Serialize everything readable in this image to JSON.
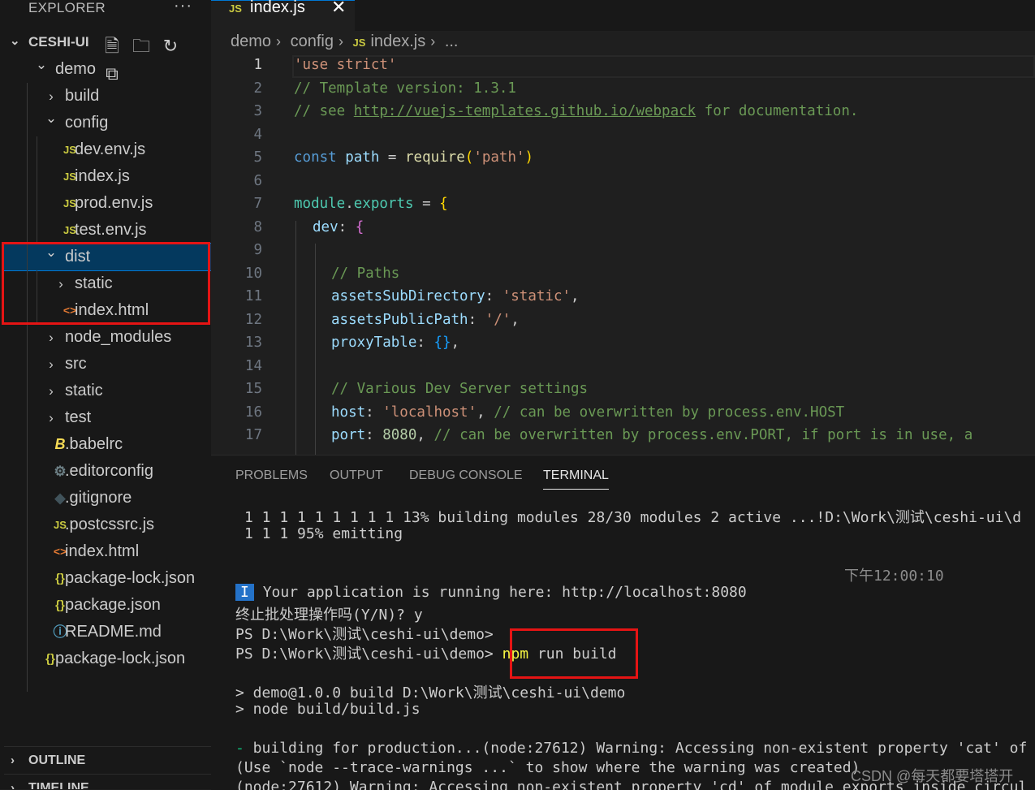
{
  "sidebar": {
    "title": "EXPLORER",
    "more": "···",
    "root": "CESHI-UI",
    "actions": [
      "new-file-icon",
      "new-folder-icon",
      "refresh-icon",
      "collapse-icon"
    ],
    "items": [
      {
        "label": "demo",
        "kind": "folder-open"
      },
      {
        "label": "build",
        "kind": "folder"
      },
      {
        "label": "config",
        "kind": "folder-open"
      },
      {
        "label": "dev.env.js",
        "kind": "js"
      },
      {
        "label": "index.js",
        "kind": "js"
      },
      {
        "label": "prod.env.js",
        "kind": "js"
      },
      {
        "label": "test.env.js",
        "kind": "js"
      },
      {
        "label": "dist",
        "kind": "folder-open"
      },
      {
        "label": "static",
        "kind": "folder"
      },
      {
        "label": "index.html",
        "kind": "html"
      },
      {
        "label": "node_modules",
        "kind": "folder"
      },
      {
        "label": "src",
        "kind": "folder"
      },
      {
        "label": "static",
        "kind": "folder"
      },
      {
        "label": "test",
        "kind": "folder"
      },
      {
        "label": ".babelrc",
        "kind": "babel"
      },
      {
        "label": ".editorconfig",
        "kind": "gear"
      },
      {
        "label": ".gitignore",
        "kind": "git"
      },
      {
        "label": ".postcssrc.js",
        "kind": "js"
      },
      {
        "label": "index.html",
        "kind": "html"
      },
      {
        "label": "package-lock.json",
        "kind": "json"
      },
      {
        "label": "package.json",
        "kind": "json"
      },
      {
        "label": "README.md",
        "kind": "info"
      },
      {
        "label": "package-lock.json",
        "kind": "json"
      }
    ],
    "icons": {
      "js": "JS",
      "json": "{}",
      "html": "<>",
      "babel": "B",
      "gear": "⚙",
      "git": "◆",
      "info": "ⓘ"
    },
    "outline": "OUTLINE",
    "timeline": "TIMELINE"
  },
  "editor": {
    "tab": {
      "icon": "JS",
      "name": "index.js",
      "close": "✕"
    },
    "breadcrumb": {
      "a": "demo",
      "b": "config",
      "icon": "JS",
      "c": "index.js",
      "d": "..."
    },
    "line_numbers": [
      "1",
      "2",
      "3",
      "4",
      "5",
      "6",
      "7",
      "8",
      "9",
      "10",
      "11",
      "12",
      "13",
      "14",
      "15",
      "16",
      "17"
    ],
    "lines": {
      "l1": "'use strict'",
      "l2": "// Template version: 1.3.1",
      "l3a": "// see ",
      "l3b": "http://vuejs-templates.github.io/webpack",
      "l3c": " for documentation.",
      "l5a": "const",
      "l5b": "path",
      "l5c": "require",
      "l5d": "'path'",
      "l7a": "module",
      "l7b": "exports",
      "l8": "dev",
      "l10": "// Paths",
      "l11a": "assetsSubDirectory",
      "l11b": "'static'",
      "l12a": "assetsPublicPath",
      "l12b": "'/'",
      "l13": "proxyTable",
      "l15": "// Various Dev Server settings",
      "l16a": "host",
      "l16b": "'localhost'",
      "l16c": "// can be overwritten by process.env.HOST",
      "l17a": "port",
      "l17b": "8080",
      "l17c": "// can be overwritten by process.env.PORT, if port is in use, a"
    }
  },
  "panel": {
    "tabs": [
      "PROBLEMS",
      "OUTPUT",
      "DEBUG CONSOLE",
      "TERMINAL"
    ],
    "terminal": {
      "t1": "1 1 1 1 1 1 1 1 1 13% building modules 28/30 modules 2 active ...!D:\\Work\\测试\\ceshi-ui\\d",
      "t2": "1 1 1 95% emitting",
      "time": "下午12:00:10",
      "mark": "I",
      "t3": "Your application is running here: http://localhost:8080",
      "t4": "终止批处理操作吗(Y/N)? y",
      "t5": "PS D:\\Work\\测试\\ceshi-ui\\demo>",
      "t6": "PS D:\\Work\\测试\\ceshi-ui\\demo>",
      "cmd_npm": "npm",
      "cmd_rest": " run build",
      "t7": "> demo@1.0.0 build D:\\Work\\测试\\ceshi-ui\\demo",
      "t8": "> node build/build.js",
      "t9_dash": "-",
      "t9": " building for production...(node:27612) Warning: Accessing non-existent property 'cat' of",
      "t10": "(Use `node --trace-warnings ...` to show where the warning was created)",
      "t11": "(node:27612) Warning: Accessing non-existent property 'cd' of module exports inside circul"
    }
  },
  "watermark": "CSDN @每天都要塔塔开"
}
